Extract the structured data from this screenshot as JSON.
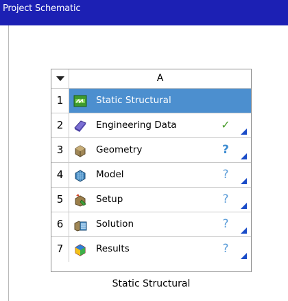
{
  "window": {
    "title": "Project Schematic"
  },
  "system": {
    "column_letter": "A",
    "caption": "Static Structural",
    "rows": [
      {
        "num": "1",
        "label": "Static Structural",
        "icon": "static-structural-icon",
        "status": "",
        "selected": true
      },
      {
        "num": "2",
        "label": "Engineering Data",
        "icon": "engineering-data-icon",
        "status": "check"
      },
      {
        "num": "3",
        "label": "Geometry",
        "icon": "geometry-icon",
        "status": "question"
      },
      {
        "num": "4",
        "label": "Model",
        "icon": "model-icon",
        "status": "question"
      },
      {
        "num": "5",
        "label": "Setup",
        "icon": "setup-icon",
        "status": "question"
      },
      {
        "num": "6",
        "label": "Solution",
        "icon": "solution-icon",
        "status": "question"
      },
      {
        "num": "7",
        "label": "Results",
        "icon": "results-icon",
        "status": "question"
      }
    ]
  },
  "colors": {
    "titlebar": "#1c20b4",
    "selected_row": "#4c8fcf",
    "check": "#4a9d2d",
    "question": "#3d8cd1"
  }
}
